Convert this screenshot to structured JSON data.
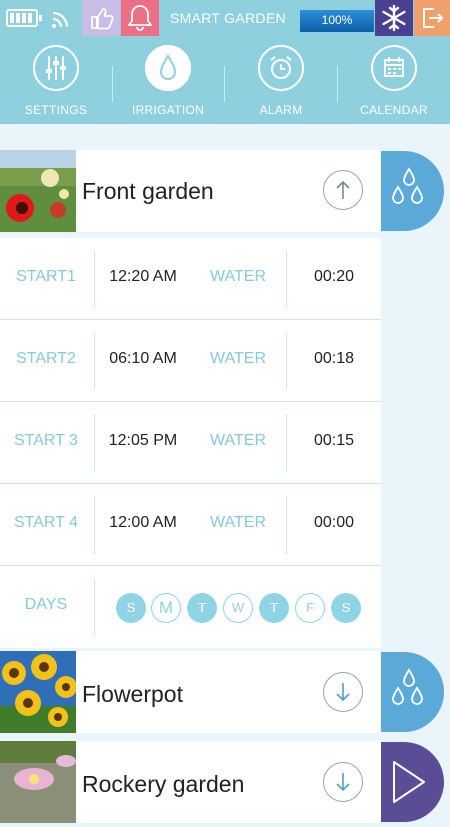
{
  "status_bar": {
    "title": "SMART GARDEN",
    "progress_label": "100%",
    "battery_icon": "battery-icon",
    "wifi_icon": "wifi-icon",
    "colors": {
      "bar": "#8fd0de",
      "like": "#c7bde6",
      "bell": "#ec6f86",
      "snow": "#4a3f91",
      "exit": "#f0a06b"
    }
  },
  "nav": {
    "items": [
      {
        "label": "SETTINGS",
        "icon": "sliders-icon"
      },
      {
        "label": "IRRIGATION",
        "icon": "water-drop-icon",
        "active": true
      },
      {
        "label": "ALARM",
        "icon": "alarm-clock-icon"
      },
      {
        "label": "CALENDAR",
        "icon": "calendar-icon"
      }
    ]
  },
  "gardens": [
    {
      "name": "Front garden",
      "expanded": true,
      "action_icon": "water-drops-icon"
    },
    {
      "name": "Flowerpot",
      "expanded": false,
      "action_icon": "water-drops-icon"
    },
    {
      "name": "Rockery garden",
      "expanded": false,
      "action_icon": "play-icon"
    }
  ],
  "schedule": {
    "rows": [
      {
        "start_label": "START1",
        "start_time": "12:20 AM",
        "water_label": "WATER",
        "water_duration": "00:20"
      },
      {
        "start_label": "START2",
        "start_time": "06:10 AM",
        "water_label": "WATER",
        "water_duration": "00:18"
      },
      {
        "start_label": "START 3",
        "start_time": "12:05 PM",
        "water_label": "WATER",
        "water_duration": "00:15"
      },
      {
        "start_label": "START 4",
        "start_time": "12:00 AM",
        "water_label": "WATER",
        "water_duration": "00:00"
      }
    ],
    "days_label": "DAYS",
    "days": [
      {
        "letter": "S",
        "active": true
      },
      {
        "letter": "M",
        "active": false
      },
      {
        "letter": "T",
        "active": true
      },
      {
        "letter": "W",
        "active": false
      },
      {
        "letter": "T",
        "active": true
      },
      {
        "letter": "F",
        "active": false
      },
      {
        "letter": "S",
        "active": true
      }
    ]
  }
}
